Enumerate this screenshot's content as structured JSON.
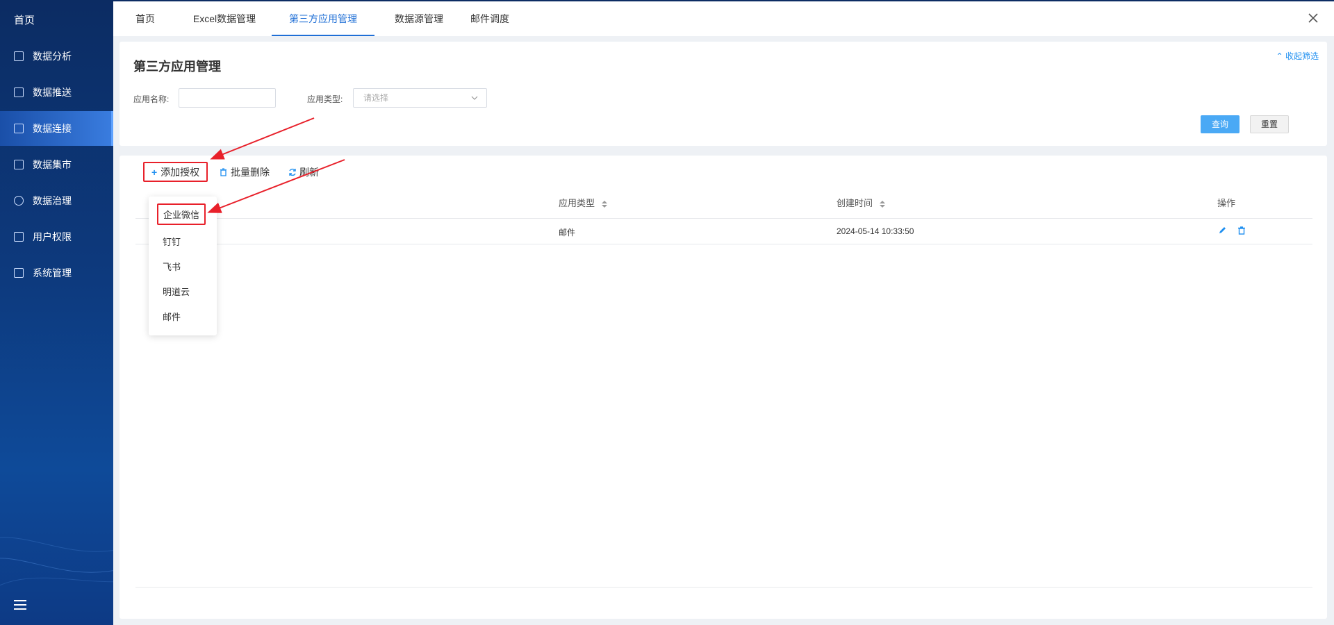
{
  "sidebar": {
    "home": "首页",
    "items": [
      {
        "label": "数据分析"
      },
      {
        "label": "数据推送"
      },
      {
        "label": "数据连接"
      },
      {
        "label": "数据集市"
      },
      {
        "label": "数据治理"
      },
      {
        "label": "用户权限"
      },
      {
        "label": "系统管理"
      }
    ],
    "active_index": 2
  },
  "tabs": [
    {
      "label": "首页"
    },
    {
      "label": "Excel数据管理"
    },
    {
      "label": "第三方应用管理"
    },
    {
      "label": "数据源管理"
    },
    {
      "label": "邮件调度"
    }
  ],
  "active_tab_index": 2,
  "filter": {
    "title": "第三方应用管理",
    "collapse_label": "收起筛选",
    "app_name_label": "应用名称:",
    "app_name_value": "",
    "app_type_label": "应用类型:",
    "app_type_placeholder": "请选择",
    "query_label": "查询",
    "reset_label": "重置"
  },
  "toolbar": {
    "add_label": "添加授权",
    "batch_delete_label": "批量删除",
    "refresh_label": "刷新"
  },
  "table": {
    "columns": [
      "应用类型",
      "创建时间",
      "操作"
    ],
    "rows": [
      {
        "app_type": "邮件",
        "created_at": "2024-05-14 10:33:50"
      }
    ]
  },
  "dropdown": {
    "items": [
      "企业微信",
      "钉钉",
      "飞书",
      "明道云",
      "邮件"
    ],
    "highlighted_index": 0
  },
  "colors": {
    "accent": "#1f6fd6",
    "highlight_red": "#e8202a",
    "primary_button": "#4aa9f5"
  }
}
